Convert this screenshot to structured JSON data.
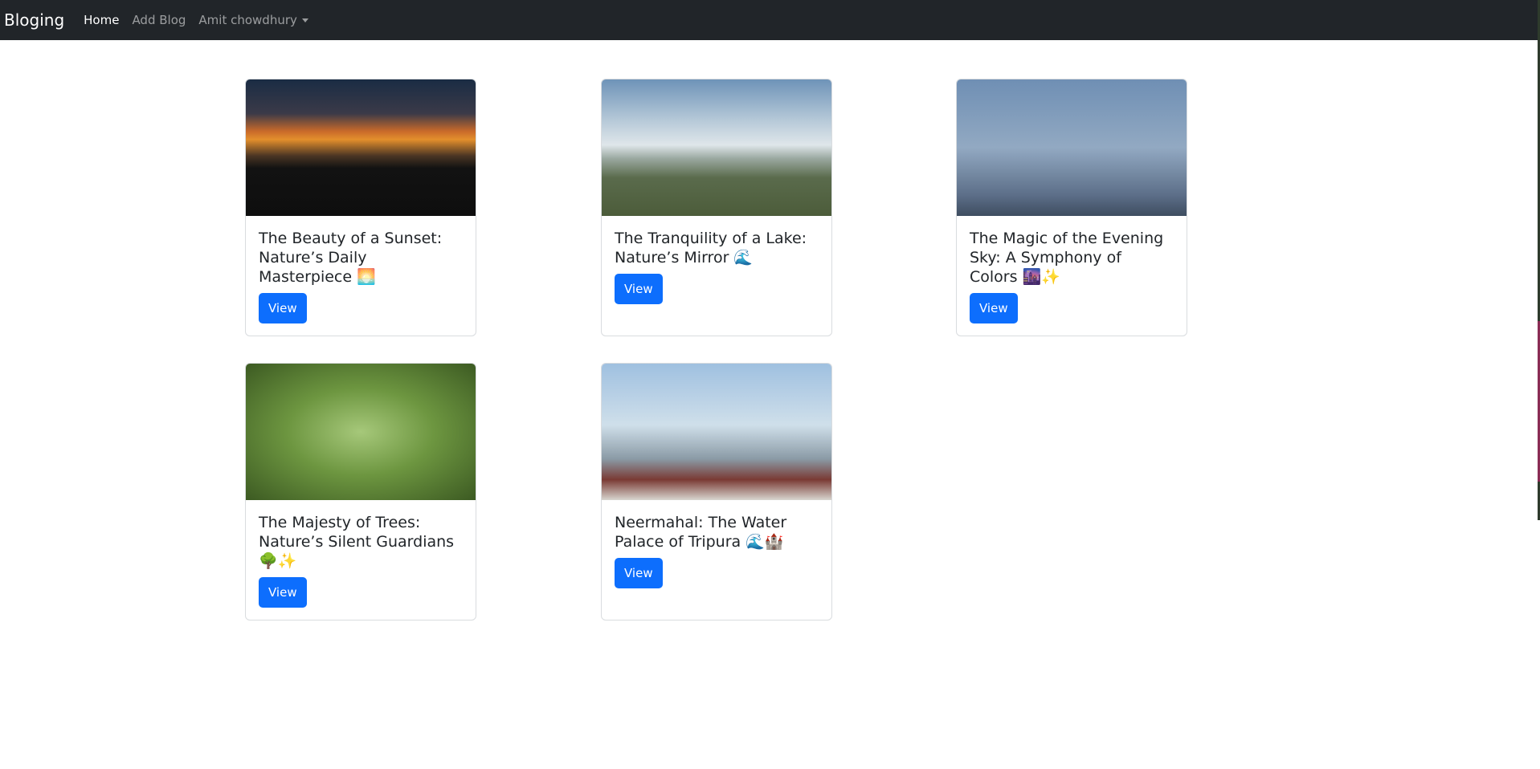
{
  "nav": {
    "brand": "Bloging",
    "links": [
      "Home",
      "Add Blog"
    ],
    "user": "Amit chowdhury"
  },
  "cards": [
    {
      "title": "The Beauty of a Sunset: Nature’s Daily Masterpiece 🌅",
      "button": "View"
    },
    {
      "title": "The Tranquility of a Lake: Nature’s Mirror 🌊",
      "button": "View"
    },
    {
      "title": "The Magic of the Evening Sky: A Symphony of Colors 🌆✨",
      "button": "View"
    },
    {
      "title": "The Majesty of Trees: Nature’s Silent Guardians 🌳✨",
      "button": "View"
    },
    {
      "title": "Neermahal: The Water Palace of Tripura 🌊🏰",
      "button": "View"
    }
  ],
  "colors": {
    "navbar": "#212529",
    "primary": "#0d6efd"
  }
}
